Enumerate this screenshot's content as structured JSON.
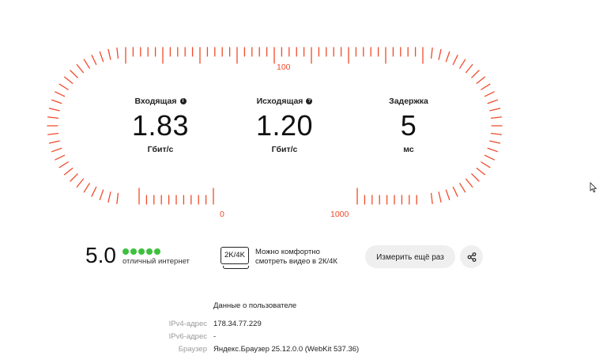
{
  "gauge": {
    "accent_color": "#f04a2a",
    "scale_labels": {
      "mid": "100",
      "low": "0",
      "high": "1000"
    }
  },
  "stats": {
    "download": {
      "title": "Входящая",
      "value": "1.83",
      "unit": "Гбит/с",
      "info_icon": "info-icon"
    },
    "upload": {
      "title": "Исходящая",
      "value": "1.20",
      "unit": "Гбит/с",
      "info_icon": "question-icon"
    },
    "latency": {
      "title": "Задержка",
      "value": "5",
      "unit": "мс"
    }
  },
  "rating": {
    "score": "5.0",
    "stars_filled": 5,
    "stars_total": 5,
    "label": "отличный интернет",
    "dot_color": "#3dc13d"
  },
  "quality": {
    "badge": "2K/4K",
    "line1": "Можно комфортно",
    "line2": "смотреть видео в 2К/4К"
  },
  "actions": {
    "retry_label": "Измерить ещё раз",
    "share_icon": "share-icon"
  },
  "user_info": {
    "title": "Данные о пользователе",
    "rows": [
      {
        "key": "IPv4-адрес",
        "value": "178.34.77.229"
      },
      {
        "key": "IPv6-адрес",
        "value": "-"
      },
      {
        "key": "Браузер",
        "value": "Яндекс.Браузер 25.12.0.0 (WebKit 537.36)"
      }
    ]
  }
}
